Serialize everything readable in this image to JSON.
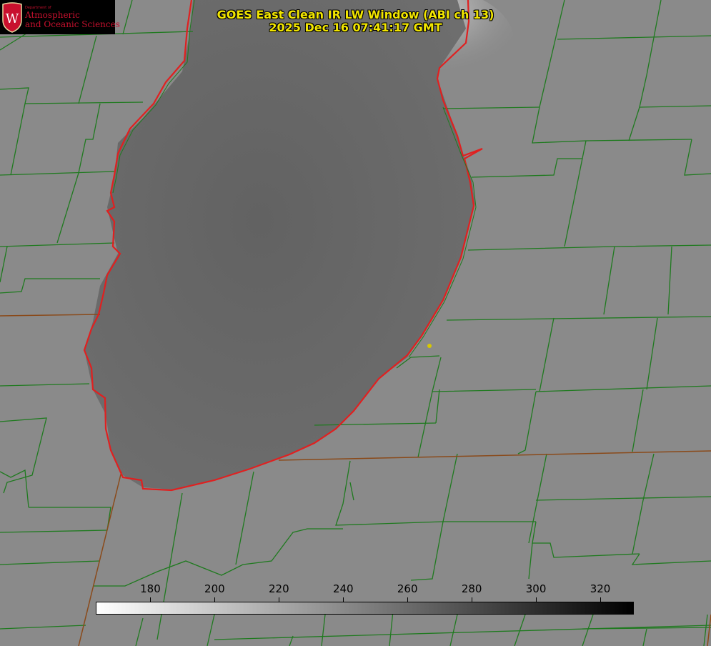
{
  "title": {
    "line1": "GOES East Clean IR LW Window (ABI ch 13)",
    "line2": "2025 Dec 16 07:41:17 GMT"
  },
  "logo": {
    "small_text": "Department of",
    "line1": "Atmospheric",
    "line2": "and Oceanic Sciences",
    "letter": "W"
  },
  "colorbar": {
    "ticks": [
      "180",
      "200",
      "220",
      "240",
      "260",
      "280",
      "300",
      "320"
    ],
    "tick_values": [
      180,
      200,
      220,
      240,
      260,
      280,
      300,
      320
    ],
    "range": [
      163,
      330
    ],
    "colormap": "white-to-black (cold = white, warm = black)"
  },
  "colors": {
    "title_text": "#f2e600",
    "boundary_lines": "#1f7a1f",
    "coastline": "#e02020",
    "marker": "#d8c800",
    "logo_red": "#c8102e"
  }
}
